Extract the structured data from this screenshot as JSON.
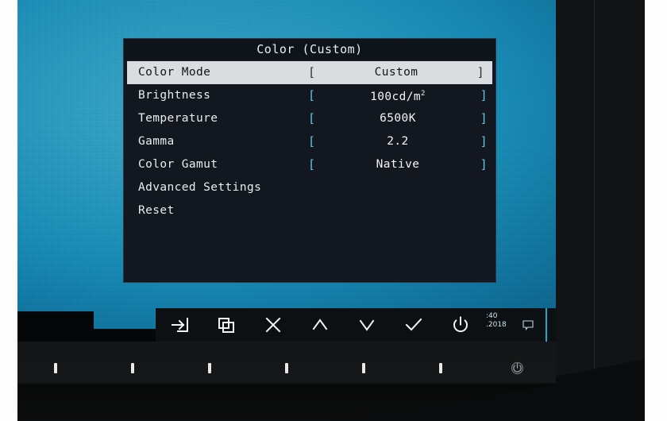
{
  "osd": {
    "title": "Color (Custom)",
    "bracket_open": "[",
    "bracket_close": "]",
    "rows": [
      {
        "label": "Color Mode",
        "value": "Custom",
        "unit": "",
        "has_value": true,
        "selected": true
      },
      {
        "label": "Brightness",
        "value": "100cd/m",
        "unit": "2",
        "has_value": true,
        "selected": false
      },
      {
        "label": "Temperature",
        "value": "6500K",
        "unit": "",
        "has_value": true,
        "selected": false
      },
      {
        "label": "Gamma",
        "value": "2.2",
        "unit": "",
        "has_value": true,
        "selected": false
      },
      {
        "label": "Color Gamut",
        "value": "Native",
        "unit": "",
        "has_value": true,
        "selected": false
      },
      {
        "label": "Advanced Settings",
        "value": "",
        "unit": "",
        "has_value": false,
        "selected": false
      },
      {
        "label": "Reset",
        "value": "",
        "unit": "",
        "has_value": false,
        "selected": false
      }
    ]
  },
  "keybar": {
    "buttons": [
      {
        "icon": "input-select-icon"
      },
      {
        "icon": "picture-by-picture-icon"
      },
      {
        "icon": "close-icon"
      },
      {
        "icon": "chevron-up-icon"
      },
      {
        "icon": "chevron-down-icon"
      },
      {
        "icon": "checkmark-icon"
      },
      {
        "icon": "power-icon"
      }
    ]
  },
  "taskbar": {
    "clock_time": ":40",
    "clock_date": ".2018",
    "notification_icon": "speech-bubble-icon"
  },
  "bezel": {
    "key_count": 6,
    "power_icon": "power-icon"
  },
  "colors": {
    "desktop": "#1b94bf",
    "osd_bg": "#131820",
    "osd_selected_bg": "#d9dde0",
    "bracket": "#63c6e0",
    "keybar_bg": "#0d1013"
  }
}
